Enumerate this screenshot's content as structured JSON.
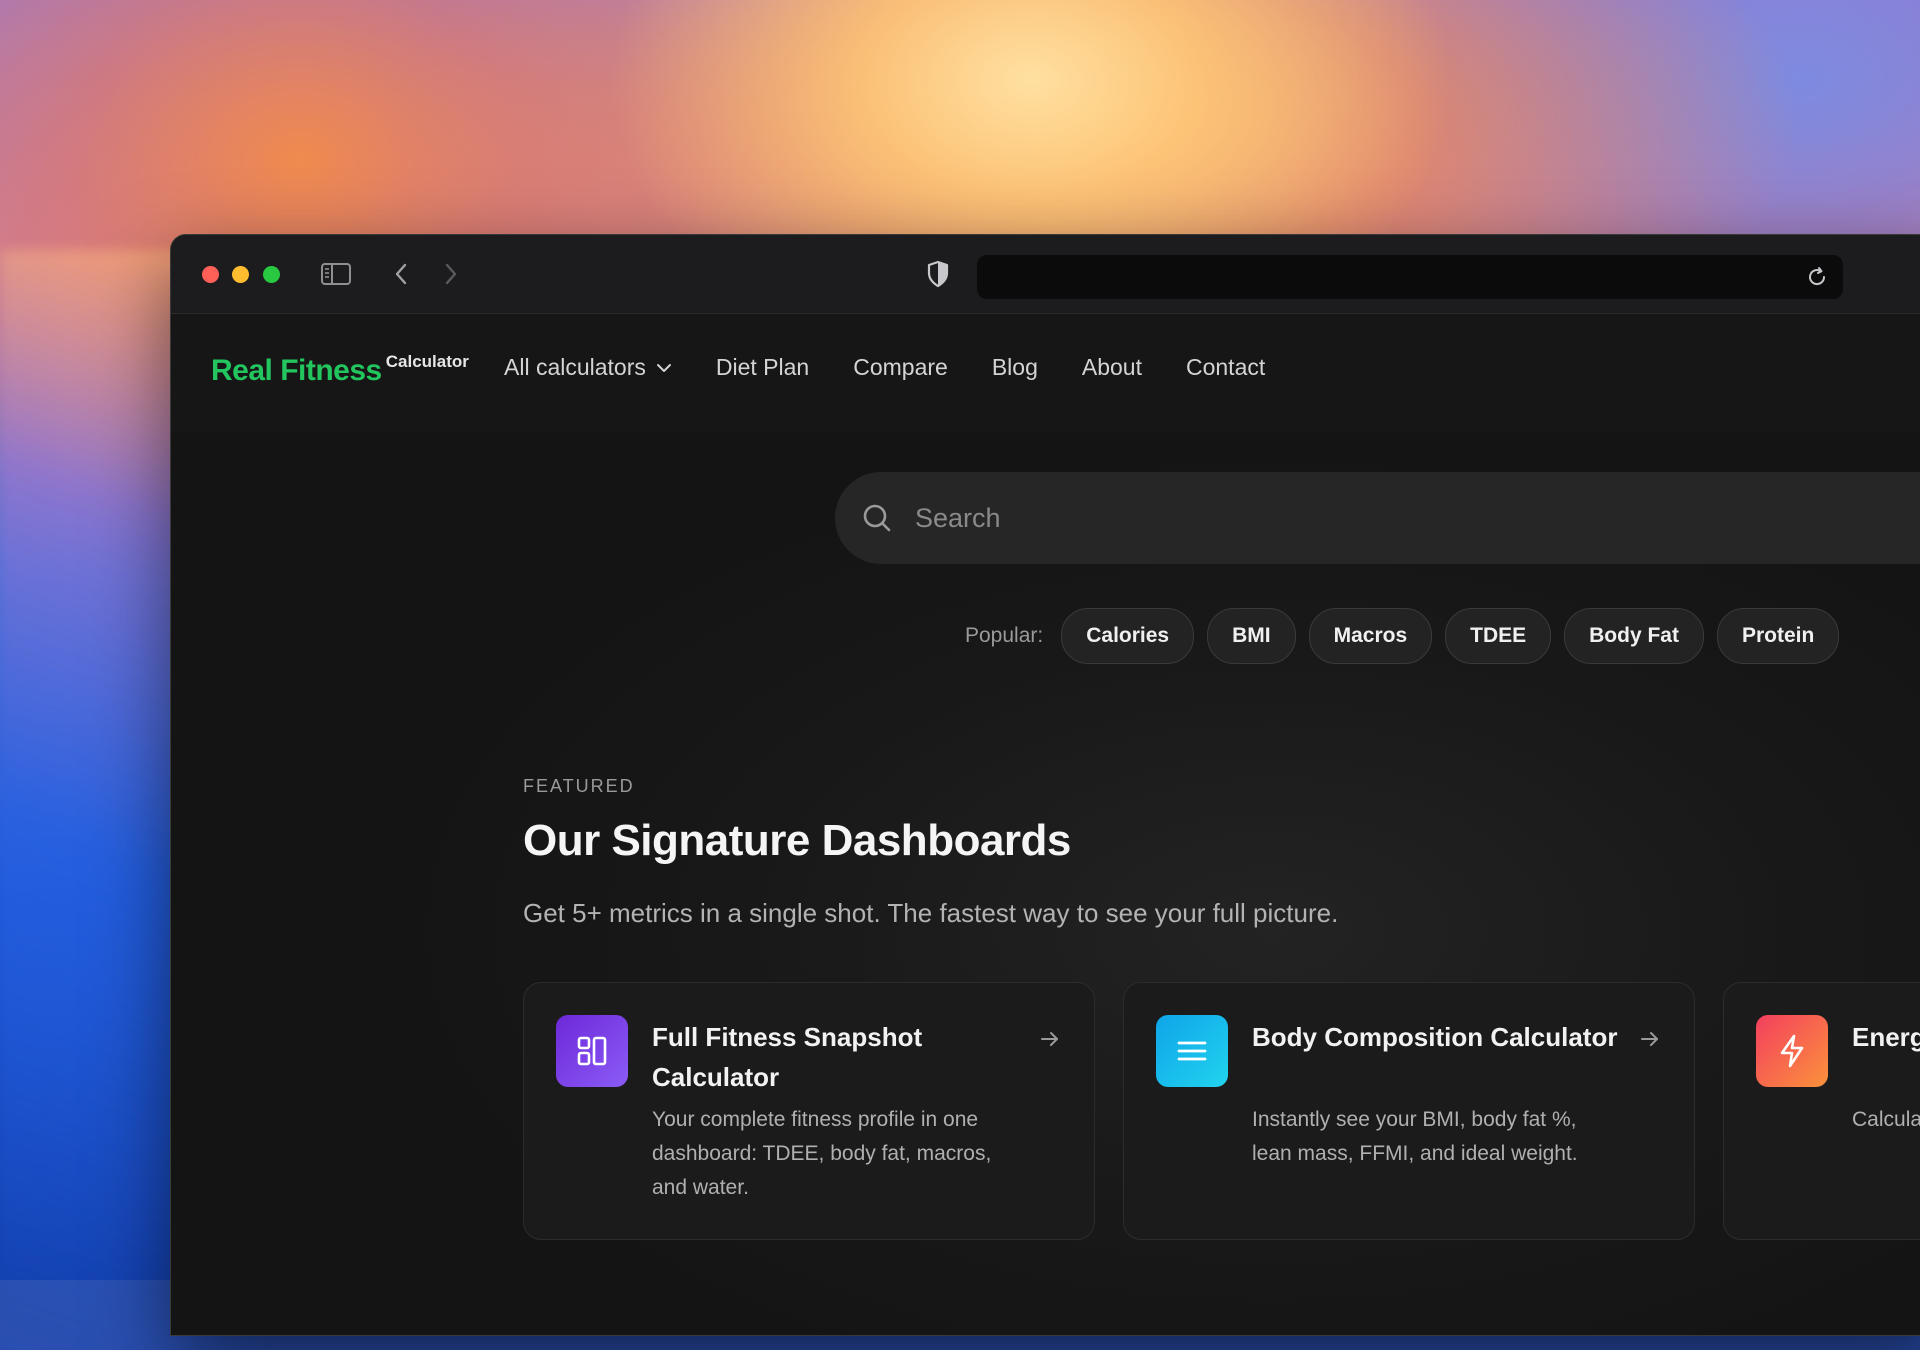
{
  "browser": {
    "url": ""
  },
  "nav": {
    "logo_main": "Real Fitness",
    "logo_sup": "Calculator",
    "links": [
      "All calculators",
      "Diet Plan",
      "Compare",
      "Blog",
      "About",
      "Contact"
    ]
  },
  "search": {
    "placeholder": "Search"
  },
  "popular": {
    "label": "Popular:",
    "chips": [
      "Calories",
      "BMI",
      "Macros",
      "TDEE",
      "Body Fat",
      "Protein"
    ]
  },
  "featured": {
    "eyebrow": "FEATURED",
    "title": "Our Signature Dashboards",
    "subtitle": "Get 5+ metrics in a single shot. The fastest way to see your full picture.",
    "cards": [
      {
        "title": "Full Fitness Snapshot Calculator",
        "description": "Your complete fitness profile in one dashboard: TDEE, body fat, macros, and water.",
        "icon": "dashboard-icon",
        "color_from": "#6d28d9",
        "color_to": "#8b5cf6"
      },
      {
        "title": "Body Composition Calculator",
        "description": "Instantly see your BMI, body fat %, lean mass, FFMI, and ideal weight.",
        "icon": "list-icon",
        "color_from": "#0ea5e9",
        "color_to": "#22d3ee"
      },
      {
        "title": "Energ",
        "description": "Calcula mainte loss or",
        "icon": "lightning-icon",
        "color_from": "#f43f5e",
        "color_to": "#fb923c"
      }
    ]
  },
  "colors": {
    "brand": "#22c55e",
    "background": "#141414"
  }
}
